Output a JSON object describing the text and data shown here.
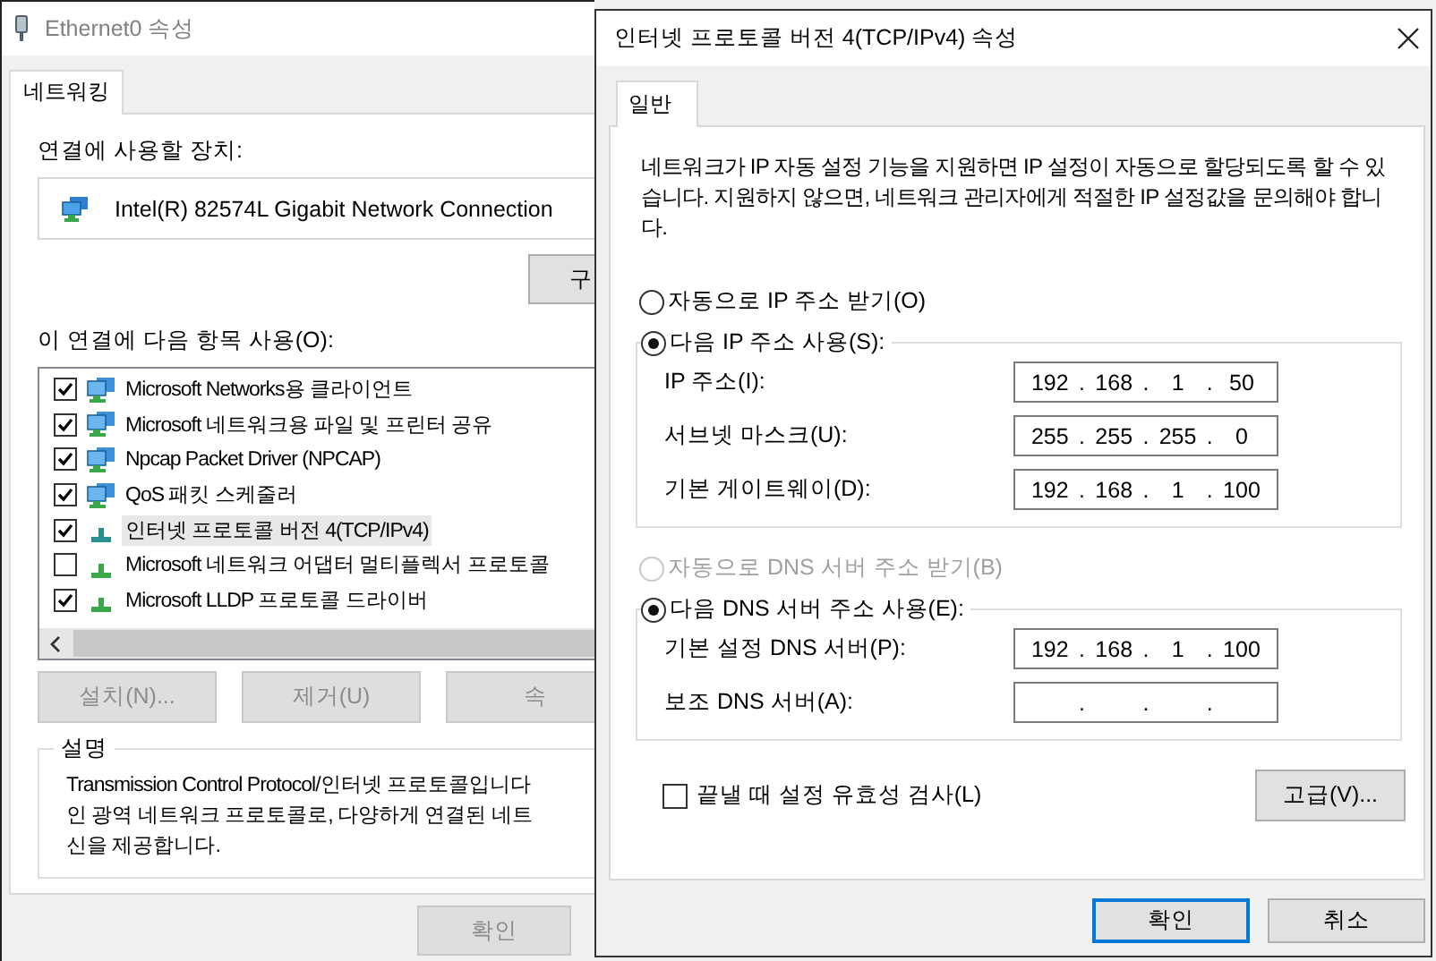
{
  "back_window": {
    "title": "Ethernet0 속성",
    "tabs": [
      {
        "label": "네트워킹",
        "selected": true
      }
    ],
    "device_label": "연결에 사용할 장치:",
    "device": "Intel(R) 82574L Gigabit Network Connection",
    "configure_button": "구",
    "items_label": "이 연결에 다음 항목 사용(O):",
    "items": [
      {
        "kind": "service",
        "label": "Microsoft Networks용 클라이언트",
        "checked": true,
        "selected": false
      },
      {
        "kind": "service",
        "label": "Microsoft 네트워크용 파일 및 프린터 공유",
        "checked": true,
        "selected": false
      },
      {
        "kind": "service",
        "label": "Npcap Packet Driver (NPCAP)",
        "checked": true,
        "selected": false
      },
      {
        "kind": "service",
        "label": "QoS 패킷 스케줄러",
        "checked": true,
        "selected": false
      },
      {
        "kind": "protocol",
        "label": "인터넷 프로토콜 버전 4(TCP/IPv4)",
        "checked": true,
        "selected": true
      },
      {
        "kind": "protocol",
        "label": "Microsoft 네트워크 어댑터 멀티플렉서 프로토콜",
        "checked": false,
        "selected": false
      },
      {
        "kind": "protocol",
        "label": "Microsoft LLDP 프로토콜 드라이버",
        "checked": true,
        "selected": false
      }
    ],
    "buttons": [
      {
        "label": "설치(N)...",
        "disabled": true
      },
      {
        "label": "제거(U)",
        "disabled": true
      },
      {
        "label": "속",
        "disabled": true
      }
    ],
    "description": {
      "title": "설명",
      "lines": [
        "Transmission Control Protocol/인터넷 프로토콜입니다",
        "인 광역 네트워크 프로토콜로, 다양하게 연결된 네트",
        "신을 제공합니다."
      ]
    },
    "footer_buttons": [
      {
        "label": "확인",
        "disabled": true
      }
    ]
  },
  "front_window": {
    "title": "인터넷 프로토콜 버전 4(TCP/IPv4) 속성",
    "tabs": [
      {
        "label": "일반",
        "selected": true
      }
    ],
    "intro": "네트워크가 IP 자동 설정 기능을 지원하면 IP 설정이 자동으로 할당되도록 할 수 있습니다. 지원하지 않으면, 네트워크 관리자에게 적절한 IP 설정값을 문의해야 합니다.",
    "separator": ".",
    "ip_options": [
      {
        "label": "자동으로 IP 주소 받기(O)",
        "selected": false,
        "disabled": false
      },
      {
        "label": "다음 IP 주소 사용(S):",
        "selected": true,
        "disabled": false
      }
    ],
    "ip_fields": [
      {
        "label": "IP 주소(I):",
        "octets": [
          "192",
          "168",
          "1",
          "50"
        ]
      },
      {
        "label": "서브넷 마스크(U):",
        "octets": [
          "255",
          "255",
          "255",
          "0"
        ]
      },
      {
        "label": "기본 게이트웨이(D):",
        "octets": [
          "192",
          "168",
          "1",
          "100"
        ]
      }
    ],
    "dns_options": [
      {
        "label": "자동으로 DNS 서버 주소 받기(B)",
        "selected": false,
        "disabled": true
      },
      {
        "label": "다음 DNS 서버 주소 사용(E):",
        "selected": true,
        "disabled": false
      }
    ],
    "dns_fields": [
      {
        "label": "기본 설정 DNS 서버(P):",
        "octets": [
          "192",
          "168",
          "1",
          "100"
        ]
      },
      {
        "label": "보조 DNS 서버(A):"
      }
    ],
    "validate": {
      "label": "끝낼 때 설정 유효성 검사(L)",
      "checked": false
    },
    "advanced_button": "고급(V)...",
    "buttons": [
      {
        "label": "확인",
        "default": true
      },
      {
        "label": "취소",
        "default": false
      }
    ]
  }
}
